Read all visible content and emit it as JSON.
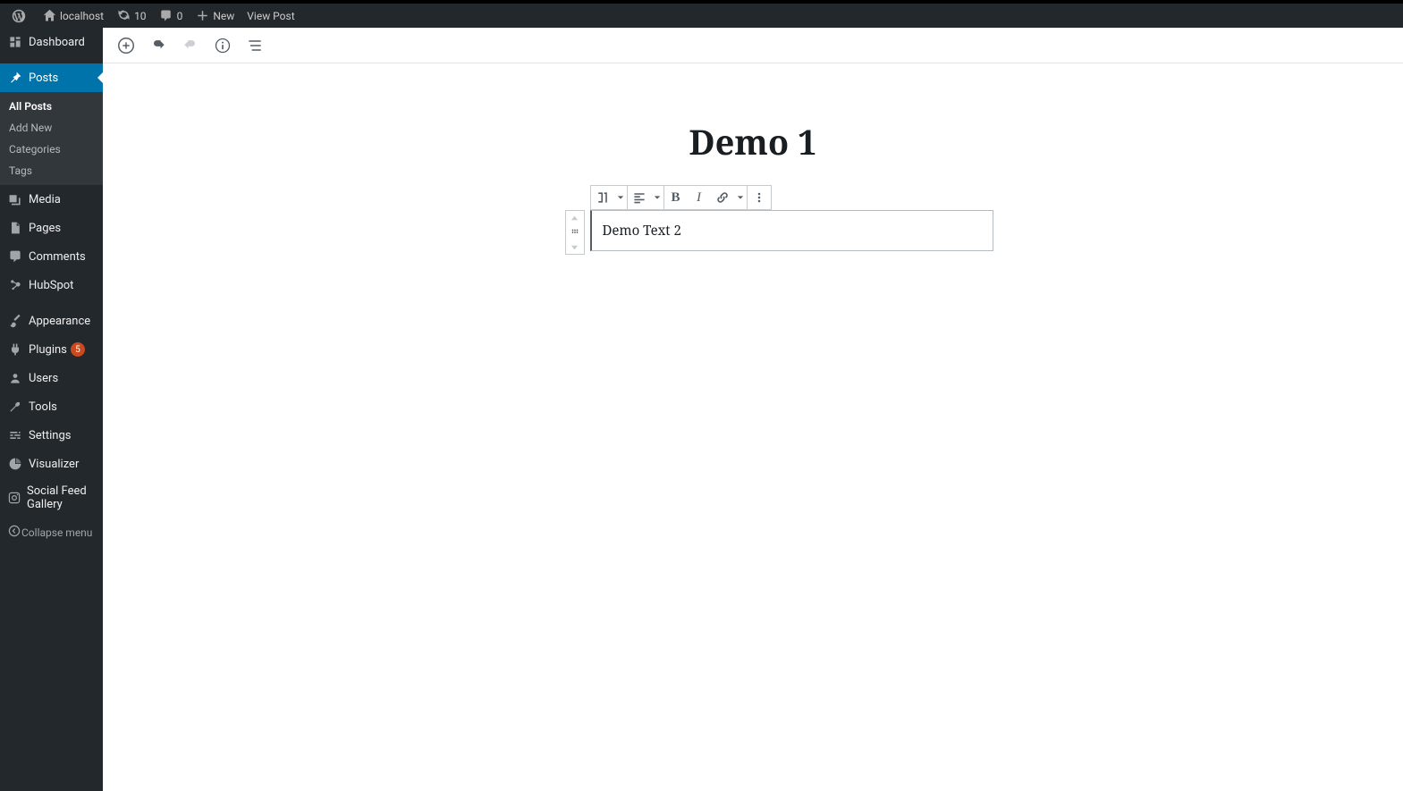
{
  "adminbar": {
    "site_name": "localhost",
    "updates_count": "10",
    "comments_count": "0",
    "new_label": "New",
    "view_post_label": "View Post"
  },
  "sidebar": {
    "dashboard": "Dashboard",
    "posts": "Posts",
    "posts_sub": {
      "all_posts": "All Posts",
      "add_new": "Add New",
      "categories": "Categories",
      "tags": "Tags"
    },
    "media": "Media",
    "pages": "Pages",
    "comments": "Comments",
    "hubspot": "HubSpot",
    "appearance": "Appearance",
    "plugins": "Plugins",
    "plugins_badge": "5",
    "users": "Users",
    "tools": "Tools",
    "settings": "Settings",
    "visualizer": "Visualizer",
    "social_feed": "Social Feed Gallery",
    "collapse": "Collapse menu"
  },
  "editor": {
    "post_title": "Demo 1",
    "block_text": "Demo Text 2"
  }
}
